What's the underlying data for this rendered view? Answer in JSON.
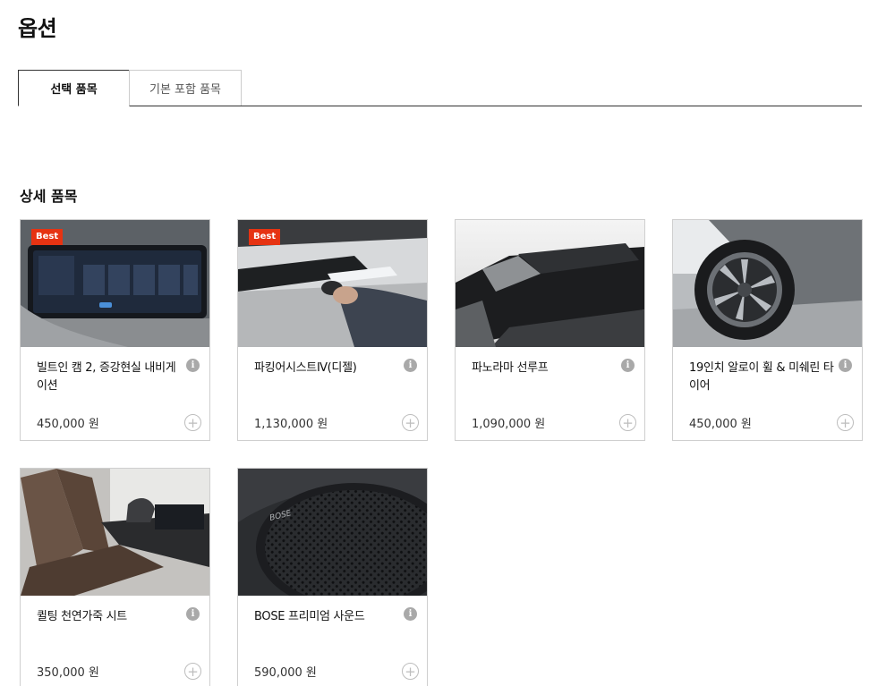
{
  "page": {
    "title": "옵션"
  },
  "tabs": [
    {
      "label": "선택 품목",
      "active": true
    },
    {
      "label": "기본 포함 품목",
      "active": false
    }
  ],
  "section": {
    "title": "상세 품목"
  },
  "accent_color": "#e63312",
  "options": [
    {
      "name": "빌트인 캠 2, 증강현실 내비게이션",
      "price": "450,000 원",
      "badge": "Best",
      "image": "infotainment-screen"
    },
    {
      "name": "파킹어시스트Ⅳ(디젤)",
      "price": "1,130,000 원",
      "badge": "Best",
      "image": "remote-key-parking"
    },
    {
      "name": "파노라마 선루프",
      "price": "1,090,000 원",
      "badge": "",
      "image": "panoramic-sunroof"
    },
    {
      "name": "19인치 알로이 휠 & 미쉐린 타이어",
      "price": "450,000 원",
      "badge": "",
      "image": "alloy-wheel"
    },
    {
      "name": "퀼팅 천연가죽 시트",
      "price": "350,000 원",
      "badge": "",
      "image": "leather-seats"
    },
    {
      "name": "BOSE 프리미엄 사운드",
      "price": "590,000 원",
      "badge": "",
      "image": "bose-speaker"
    }
  ]
}
